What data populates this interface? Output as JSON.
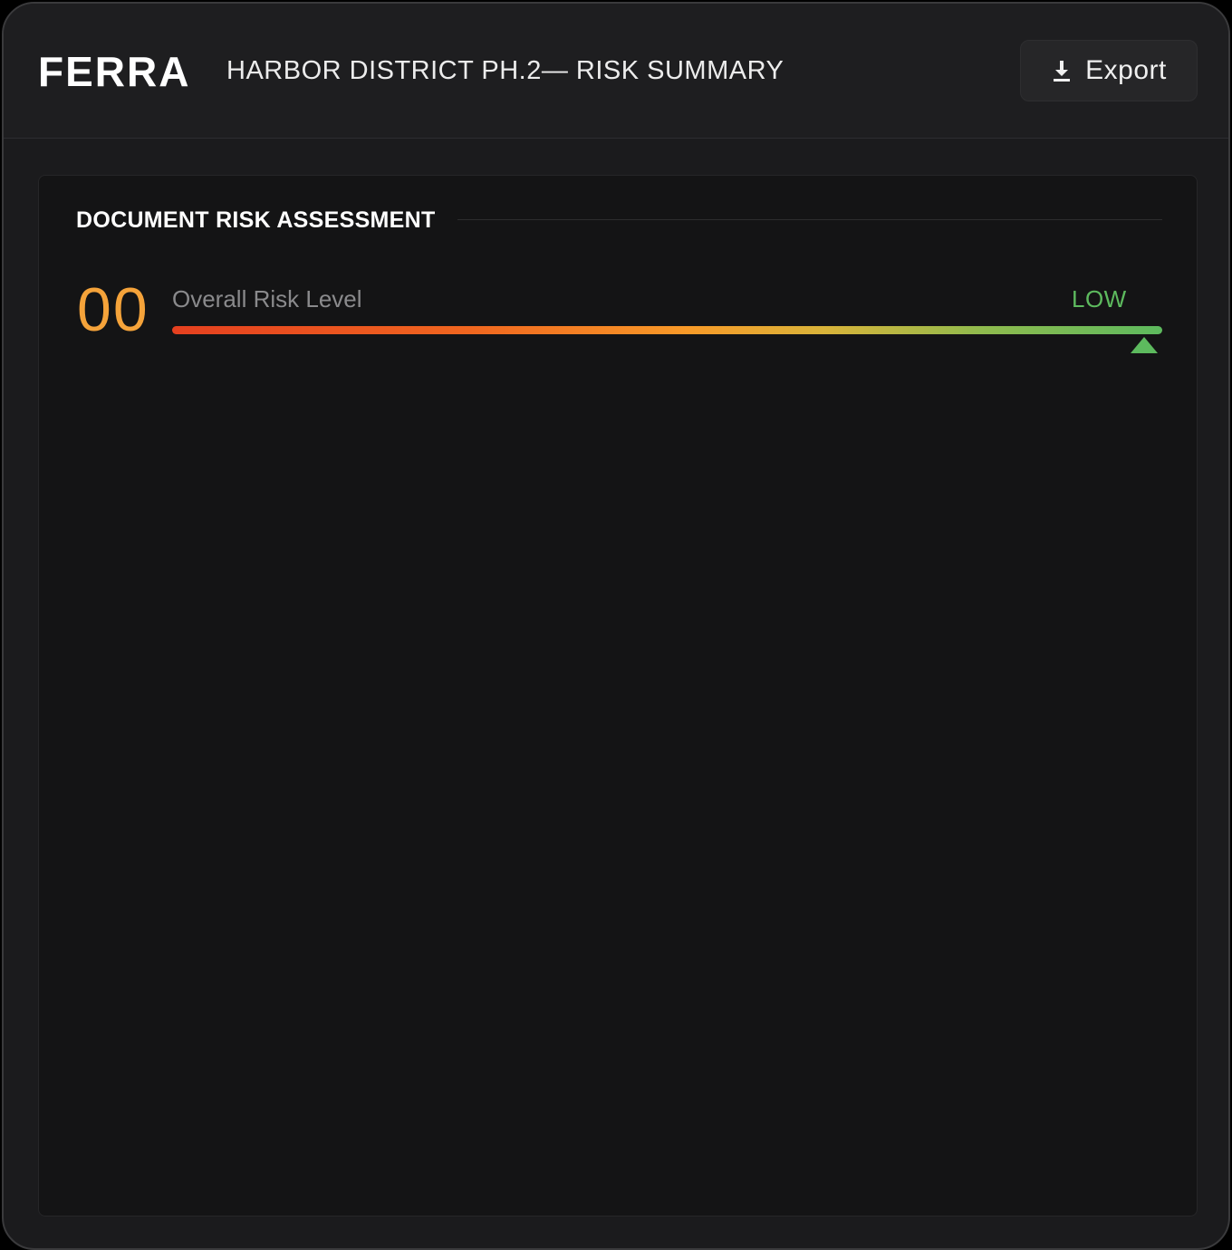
{
  "header": {
    "brand": "FERRA",
    "title": "HARBOR DISTRICT PH.2— RISK SUMMARY",
    "export_label": "Export",
    "export_icon": "download-icon"
  },
  "assessment": {
    "section_title": "DOCUMENT RISK ASSESSMENT",
    "score": "00",
    "label": "Overall Risk Level",
    "level": "LOW",
    "marker_position_fraction": 0.982,
    "marker_icon": "triangle-up-icon",
    "colors": {
      "score": "#f5a33a",
      "level": "#5dba5e",
      "gradient_start": "#e5401f",
      "gradient_mid": "#f89a28",
      "gradient_end": "#5dba5e"
    }
  }
}
